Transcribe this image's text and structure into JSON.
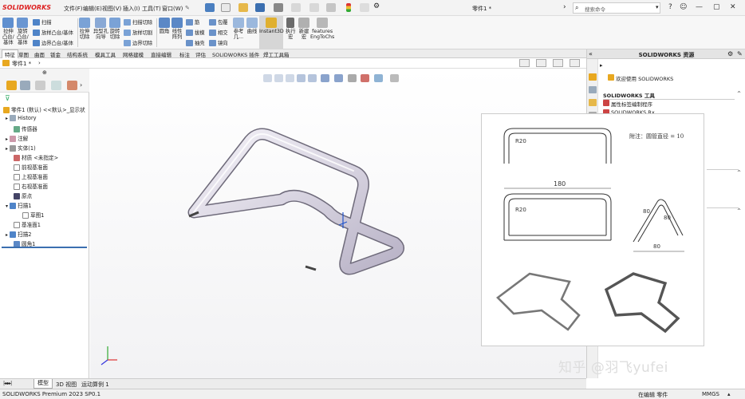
{
  "app": {
    "brand": "SOLIDWORKS",
    "document_title": "零件1 *",
    "search_placeholder": "搜索命令"
  },
  "menu": [
    "文件(F)",
    "编辑(E)",
    "视图(V)",
    "插入(I)",
    "工具(T)",
    "窗口(W)"
  ],
  "ribbon": {
    "extrude_boss": "拉伸\n凸台/\n基体",
    "revolve_boss": "旋转\n凸台/\n基体",
    "sweep": "扫描",
    "loft_boss": "放样凸台/基体",
    "boundary_boss": "边界凸台/基体",
    "extrude_cut": "拉伸\n切除",
    "hole_wizard": "异型孔\n向导",
    "revolve_cut": "旋转\n切除",
    "sweep_cut": "扫描切除",
    "loft_cut": "放样切割",
    "boundary_cut": "边界切除",
    "fillet": "圆角",
    "linear_pattern": "线性\n阵列",
    "rib": "筋",
    "draft": "拔模",
    "shell": "抽壳",
    "wrap": "包覆",
    "intersect": "相交",
    "mirror": "镜向",
    "ref_geometry": "参考\n几...",
    "curves": "曲线",
    "instant3d": "Instant3D",
    "execute_macro": "执行\n宏",
    "new_macro": "新建\n宏",
    "features_eng": "features\nEngToChs"
  },
  "tabs": [
    "特征",
    "草图",
    "曲面",
    "钣金",
    "结构系统",
    "模具工具",
    "网格建模",
    "直接编辑",
    "标注",
    "评估",
    "SOLIDWORKS 插件",
    "焊工工具箱"
  ],
  "active_tab": "特征",
  "part_tab": "零件1 *",
  "feature_tree": {
    "root": "零件1 (默认) <<默认>_显示状",
    "items": [
      "History",
      "传感器",
      "注解",
      "实体(1)",
      "材质 <未指定>",
      "前视基准面",
      "上视基准面",
      "右视基准面",
      "原点",
      "扫描1",
      "草图1",
      "基准面1",
      "扫描2",
      "圆角1"
    ]
  },
  "right_panel": {
    "title": "SOLIDWORKS 资源",
    "welcome": "欢迎使用 SOLIDWORKS",
    "tools_header": "SOLIDWORKS 工具",
    "tools_item": "属性标签编制程序",
    "tools_item2": "SOLIDWORKS Rx"
  },
  "drawing": {
    "note": "附注：圆管直径 = 10",
    "dims": {
      "r20": "R20",
      "width": "180",
      "h80": "80",
      "w80": "80",
      "r20b": "R20",
      "d80": "80"
    }
  },
  "bottom_tabs": [
    "模型",
    "3D 视图",
    "运动算例 1"
  ],
  "active_bottom_tab": "模型",
  "status": {
    "version": "SOLIDWORKS Premium 2023 SP0.1",
    "mode": "在编辑 零件",
    "units": "MMGS"
  },
  "watermark": "知乎 @羽飞yufei",
  "colors": {
    "brand_red": "#d22222",
    "accent_blue": "#2a6fb5",
    "panel_bg": "#f4f4f4"
  }
}
